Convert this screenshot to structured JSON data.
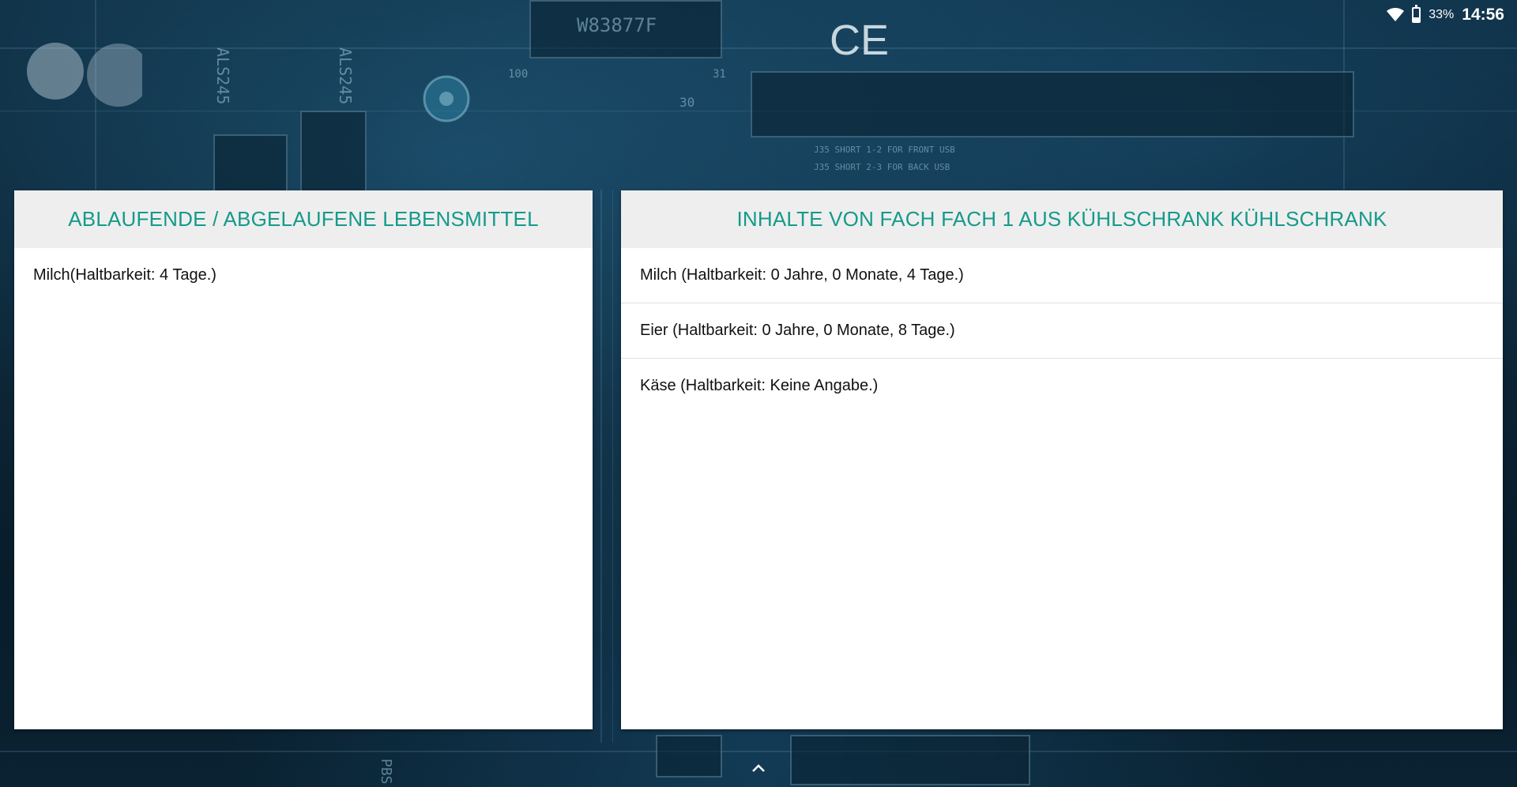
{
  "status_bar": {
    "battery_percent": "33%",
    "battery_level": 0.33,
    "time": "14:56",
    "icons": [
      "wifi-icon",
      "battery-icon"
    ]
  },
  "background": {
    "labels": [
      "W83877F",
      "CE",
      "ALS245",
      "ALS245",
      "J35 SHORT 1-2 FOR FRONT USB",
      "J35 SHORT 2-3 FOR BACK USB",
      "100",
      "31",
      "30",
      "PBS"
    ]
  },
  "left_panel": {
    "title": "ABLAUFENDE / ABGELAUFENE LEBENSMITTEL",
    "items": [
      "Milch(Haltbarkeit: 4 Tage.)"
    ]
  },
  "right_panel": {
    "title": "INHALTE VON FACH FACH 1 AUS KÜHLSCHRANK KÜHLSCHRANK",
    "items": [
      "Milch (Haltbarkeit: 0 Jahre, 0 Monate, 4 Tage.)",
      "Eier  (Haltbarkeit: 0 Jahre, 0 Monate, 8 Tage.)",
      "Käse (Haltbarkeit: Keine Angabe.)"
    ]
  },
  "navigation": {
    "icon": "chevron-up-icon"
  },
  "colors": {
    "accent": "#159a8a",
    "header_bg": "#eeeeee"
  }
}
